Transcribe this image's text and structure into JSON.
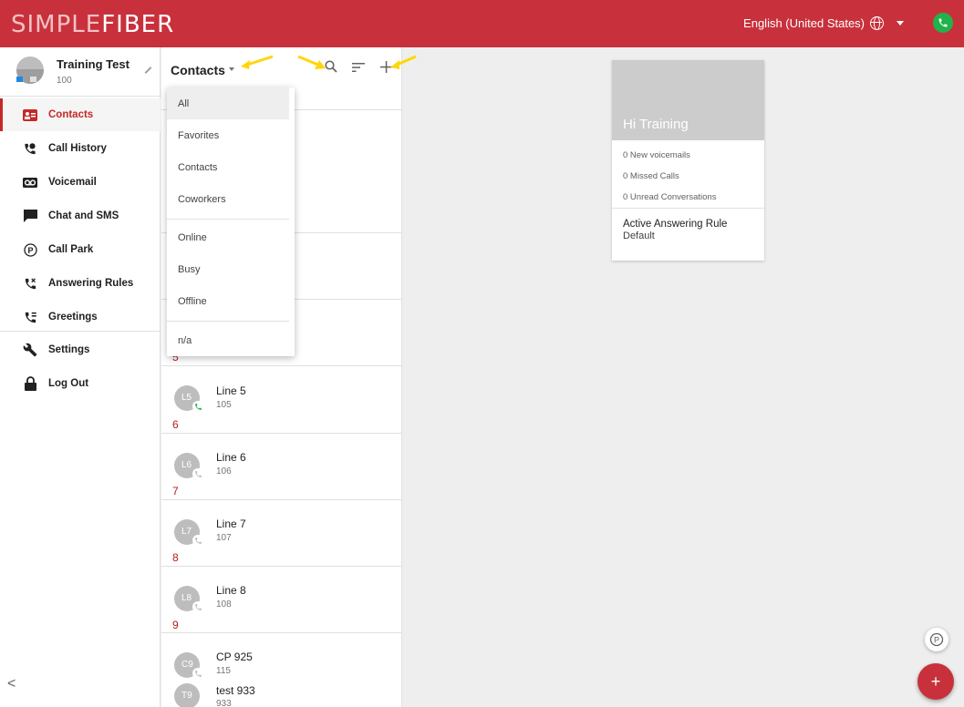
{
  "header": {
    "logo_part1": "SIMPLE",
    "logo_part2": "FIBER",
    "language": "English (United States)",
    "brand_color": "#c8313b"
  },
  "sidebar": {
    "user_name": "Training Test",
    "user_ext": "100",
    "items": [
      {
        "label": "Contacts",
        "icon": "contacts-icon"
      },
      {
        "label": "Call History",
        "icon": "call-history-icon"
      },
      {
        "label": "Voicemail",
        "icon": "voicemail-icon"
      },
      {
        "label": "Chat and SMS",
        "icon": "chat-icon"
      },
      {
        "label": "Call Park",
        "icon": "call-park-icon"
      },
      {
        "label": "Answering Rules",
        "icon": "answering-rules-icon"
      },
      {
        "label": "Greetings",
        "icon": "greetings-icon"
      },
      {
        "label": "Settings",
        "icon": "wrench-icon"
      },
      {
        "label": "Log Out",
        "icon": "lock-icon"
      }
    ],
    "collapse_glyph": "<"
  },
  "contacts": {
    "title": "Contacts",
    "rows": [
      {
        "letter": "5",
        "initials": "L5",
        "name": "Line 5",
        "ext": "105",
        "status": "green"
      },
      {
        "letter": "6",
        "initials": "L6",
        "name": "Line 6",
        "ext": "106",
        "status": "grey"
      },
      {
        "letter": "7",
        "initials": "L7",
        "name": "Line 7",
        "ext": "107",
        "status": "grey"
      },
      {
        "letter": "8",
        "initials": "L8",
        "name": "Line 8",
        "ext": "108",
        "status": "grey"
      },
      {
        "letter": "9",
        "initials": "C9",
        "name": "CP 925",
        "ext": "115",
        "status": "grey"
      },
      {
        "letter": "",
        "initials": "T9",
        "name": "test 933",
        "ext": "933",
        "status": "grey"
      }
    ]
  },
  "filter_menu": {
    "items": [
      "All",
      "Favorites",
      "Contacts",
      "Coworkers",
      "Online",
      "Busy",
      "Offline",
      "n/a"
    ],
    "selected": "All"
  },
  "summary": {
    "greeting": "Hi Training",
    "new_voicemails": "0 New voicemails",
    "missed_calls": "0 Missed Calls",
    "unread": "0 Unread Conversations",
    "rule_label": "Active Answering Rule",
    "rule_value": "Default"
  },
  "fab": {
    "park_label": "P",
    "add_label": "+"
  }
}
